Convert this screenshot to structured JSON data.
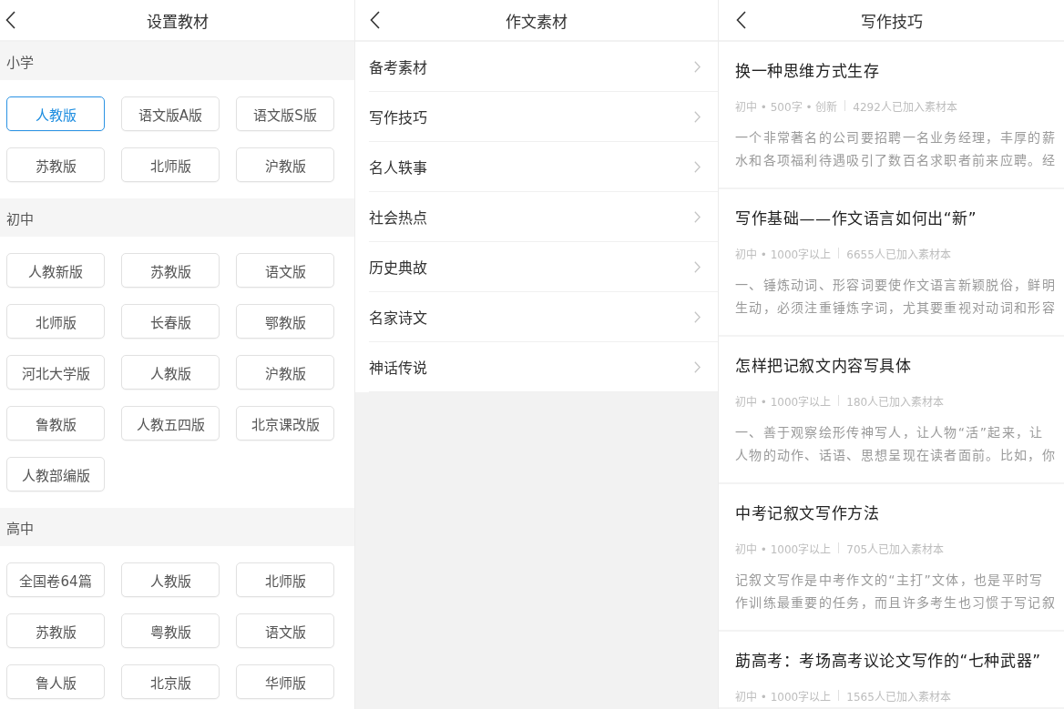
{
  "screens": [
    {
      "kind": "textbook_settings",
      "title": "设置教材",
      "sections": [
        {
          "heading": "小学",
          "options": [
            {
              "label": "人教版",
              "selected": true
            },
            {
              "label": "语文版A版",
              "selected": false
            },
            {
              "label": "语文版S版",
              "selected": false
            },
            {
              "label": "苏教版",
              "selected": false
            },
            {
              "label": "北师版",
              "selected": false
            },
            {
              "label": "沪教版",
              "selected": false
            }
          ]
        },
        {
          "heading": "初中",
          "options": [
            {
              "label": "人教新版",
              "selected": false
            },
            {
              "label": "苏教版",
              "selected": false
            },
            {
              "label": "语文版",
              "selected": false
            },
            {
              "label": "北师版",
              "selected": false
            },
            {
              "label": "长春版",
              "selected": false
            },
            {
              "label": "鄂教版",
              "selected": false
            },
            {
              "label": "河北大学版",
              "selected": false
            },
            {
              "label": "人教版",
              "selected": false
            },
            {
              "label": "沪教版",
              "selected": false
            },
            {
              "label": "鲁教版",
              "selected": false
            },
            {
              "label": "人教五四版",
              "selected": false
            },
            {
              "label": "北京课改版",
              "selected": false
            },
            {
              "label": "人教部编版",
              "selected": false
            }
          ]
        },
        {
          "heading": "高中",
          "options": [
            {
              "label": "全国卷64篇",
              "selected": false
            },
            {
              "label": "人教版",
              "selected": false
            },
            {
              "label": "北师版",
              "selected": false
            },
            {
              "label": "苏教版",
              "selected": false
            },
            {
              "label": "粤教版",
              "selected": false
            },
            {
              "label": "语文版",
              "selected": false
            },
            {
              "label": "鲁人版",
              "selected": false
            },
            {
              "label": "北京版",
              "selected": false
            },
            {
              "label": "华师版",
              "selected": false
            }
          ]
        }
      ]
    },
    {
      "kind": "material_menu",
      "title": "作文素材",
      "items": [
        "备考素材",
        "写作技巧",
        "名人轶事",
        "社会热点",
        "历史典故",
        "名家诗文",
        "神话传说"
      ]
    },
    {
      "kind": "article_list",
      "title": "写作技巧",
      "articles": [
        {
          "title": "换一种思维方式生存",
          "meta": "初中 • 500字 • 创新",
          "readers": "4292人已加入素材本",
          "excerpt_lines": [
            "一个非常著名的公司要招聘一名业务经理，丰厚的薪",
            "水和各项福利待遇吸引了数百名求职者前来应聘。经"
          ]
        },
        {
          "title": "写作基础——作文语言如何出“新”",
          "meta": "初中 • 1000字以上",
          "readers": "6655人已加入素材本",
          "excerpt_lines": [
            "一、锤炼动词、形容词要使作文语言新颖脱俗，鲜明",
            "生动，必须注重锤炼字词，尤其要重视对动词和形容"
          ]
        },
        {
          "title": "怎样把记叙文内容写具体",
          "meta": "初中 • 1000字以上",
          "readers": "180人已加入素材本",
          "excerpt_lines": [
            "一、善于观察绘形传神写人，让人物“活”起来，让",
            "人物的动作、话语、思想呈现在读者面前。比如，你"
          ]
        },
        {
          "title": "中考记叙文写作方法",
          "meta": "初中 • 1000字以上",
          "readers": "705人已加入素材本",
          "excerpt_lines": [
            "记叙文写作是中考作文的“主打”文体，也是平时写",
            "作训练最重要的任务，而且许多考生也习惯于写记叙"
          ]
        },
        {
          "title": "莇高考：考场高考议论文写作的“七种武器”",
          "meta": "初中 • 1000字以上",
          "readers": "1565人已加入素材本"
        }
      ]
    }
  ]
}
